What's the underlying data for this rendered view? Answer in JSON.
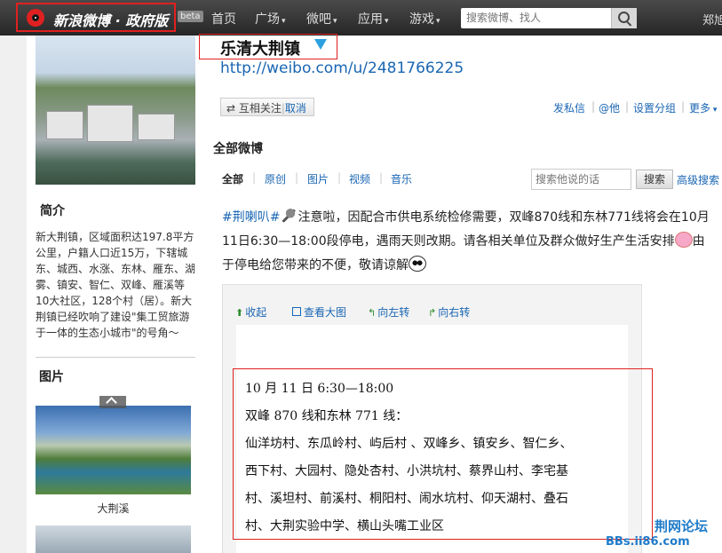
{
  "topbar": {
    "brand": "新浪微博 · 政府版",
    "beta": "beta",
    "nav": [
      {
        "label": "首页",
        "caret": ""
      },
      {
        "label": "广场",
        "caret": "▾"
      },
      {
        "label": "微吧",
        "caret": "▾"
      },
      {
        "label": "应用",
        "caret": "▾"
      },
      {
        "label": "游戏",
        "caret": "▾"
      }
    ],
    "search_placeholder": "搜索微博、找人",
    "username": "郑旭"
  },
  "sidebar": {
    "intro_title": "简介",
    "intro_text": "新大荆镇，区域面积达197.8平方公里，户籍人口近15万，下辖城东、城西、水涨、东林、雁东、湖雾、镇安、智仁、双峰、雁溪等10大社区，128个村（居）。新大荆镇已经吹响了建设\"集工贸旅游于一体的生态小城市\"的号角～",
    "photos_title": "图片",
    "photo_caption": "大荆溪"
  },
  "profile": {
    "name": "乐清大荆镇",
    "url": "http://weibo.com/u/2481766225",
    "follow_status": "⇄ 互相关注",
    "follow_cancel": "取消",
    "actions": [
      "发私信",
      "@他",
      "设置分组",
      "更多"
    ]
  },
  "feed": {
    "section_title": "全部微博",
    "tabs": [
      "全部",
      "原创",
      "图片",
      "视频",
      "音乐"
    ],
    "search_placeholder": "搜索他说的话",
    "search_button": "搜索",
    "advanced_search": "高级搜索"
  },
  "post": {
    "hashtag": "#荆喇叭#",
    "text1": "注意啦，因配合市供电系统检修需要，双峰870线和东林771线将会在10月11日6:30—18:00段停电，遇雨天则改期。请各相关单位及群众做好生产生活安排",
    "text2": "由于停电给您带来的不便，敬请谅解",
    "image_tools": [
      "收起",
      "查看大图",
      "向左转",
      "向右转"
    ],
    "image_lines": [
      "10 月 11 日      6:30—18:00",
      "双峰 870 线和东林 771 线：",
      "仙洋坊村、东瓜岭村、屿后村 、双峰乡、镇安乡、智仁乡、",
      "西下村、大园村、隐处杏村、小洪坑村、蔡界山村、李宅基",
      "村、溪坦村、前溪村、桐阳村、闹水坑村、仰天湖村、叠石",
      "村、大荆实验中学、横山头嘴工业区"
    ]
  },
  "watermark": {
    "forum": "荆网论坛",
    "url": "BBs.ii86.com"
  }
}
